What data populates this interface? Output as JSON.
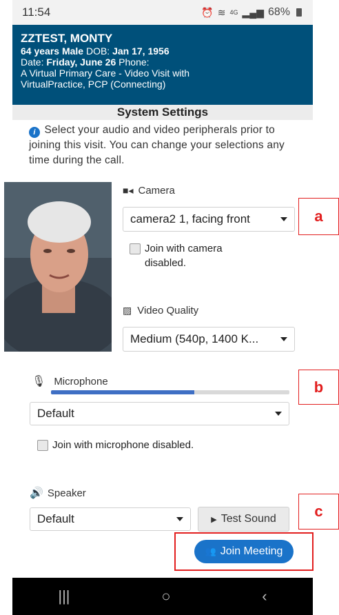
{
  "status_bar": {
    "time": "11:54",
    "signal": "4G",
    "battery": "68%"
  },
  "patient": {
    "name": "ZZTEST, MONTY",
    "age_sex": "64 years Male",
    "dob_label": "DOB:",
    "dob": "Jan 17, 1956",
    "date_label": "Date:",
    "date": "Friday, June 26",
    "phone_label": "Phone:",
    "visit_line1": "A Virtual Primary Care - Video Visit with",
    "visit_line2": "VirtualPractice, PCP (Connecting)"
  },
  "settings": {
    "title": "System Settings",
    "intro": "Select your audio and video peripherals prior to joining this visit. You can change your selections any time during the call."
  },
  "camera": {
    "label": "Camera",
    "selected": "camera2 1, facing front",
    "join_disabled_label": "Join with camera disabled."
  },
  "video_quality": {
    "label": "Video Quality",
    "selected": "Medium (540p, 1400 K..."
  },
  "microphone": {
    "label": "Microphone",
    "level": 0.6,
    "selected": "Default",
    "join_disabled_label": "Join with microphone disabled."
  },
  "speaker": {
    "label": "Speaker",
    "selected": "Default",
    "test_label": "Test Sound"
  },
  "join_label": "Join Meeting",
  "markers": {
    "a": "a",
    "b": "b",
    "c": "c"
  },
  "colors": {
    "header": "#00507a",
    "accent": "#1a73c9",
    "marker": "#e21e1e"
  }
}
